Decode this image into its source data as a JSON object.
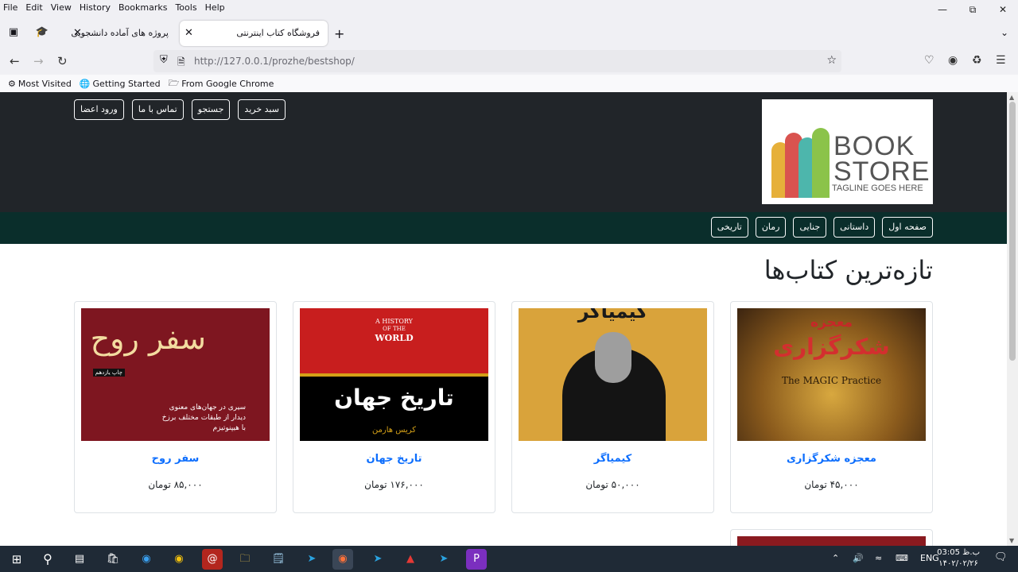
{
  "menubar": {
    "items": [
      "File",
      "Edit",
      "View",
      "History",
      "Bookmarks",
      "Tools",
      "Help"
    ]
  },
  "tabs": [
    {
      "title": "پروژه های آماده دانشجویی",
      "active": false
    },
    {
      "title": "فروشگاه کتاب اینترنتی",
      "active": true
    }
  ],
  "addressbar": {
    "url": "http://127.0.0.1/prozhe/bestshop/"
  },
  "bookmarks": [
    {
      "label": "Most Visited",
      "icon": "gear-icon"
    },
    {
      "label": "Getting Started",
      "icon": "globe-icon"
    },
    {
      "label": "From Google Chrome",
      "icon": "folder-icon"
    }
  ],
  "site": {
    "logo": {
      "line1": "BOOK",
      "line2": "STORE",
      "tagline": "TAGLINE GOES HERE"
    },
    "top_buttons": [
      "سبد خرید",
      "جستجو",
      "تماس با ما",
      "ورود اعضا"
    ],
    "categories": [
      "صفحه اول",
      "داستانی",
      "جنایی",
      "رمان",
      "تاریخی"
    ],
    "section_title": "تازه‌ترین کتاب‌ها",
    "books": [
      {
        "title": "معجزه شکرگزاری",
        "price": "۴۵,۰۰۰ تومان",
        "cover": {
          "top": "معجزه",
          "main": "شکرگزاری",
          "en": "The MAGIC Practice"
        }
      },
      {
        "title": "کیمیاگر",
        "price": "۵۰,۰۰۰ تومان",
        "cover": {
          "top": "کیمیاگر"
        }
      },
      {
        "title": "تاریخ جهان",
        "price": "۱۷۶,۰۰۰ تومان",
        "cover": {
          "en1": "A HISTORY",
          "en2": "OF THE",
          "en3": "WORLD",
          "main": "تاریخ جهان",
          "author": "کریس هارمن"
        }
      },
      {
        "title": "سفر روح",
        "price": "۸۵,۰۰۰ تومان",
        "cover": {
          "main": "سفر روح",
          "edition": "چاپ یازدهم",
          "desc1": "سیری در جهان‌های معنوی",
          "desc2": "دیدار از طبقات مختلف برزخ",
          "desc3": "با هیپنوتیزم"
        }
      }
    ]
  },
  "taskbar": {
    "lang": "ENG",
    "time": "03:05 ب.ظ",
    "date": "۱۴۰۲/۰۲/۲۶"
  }
}
